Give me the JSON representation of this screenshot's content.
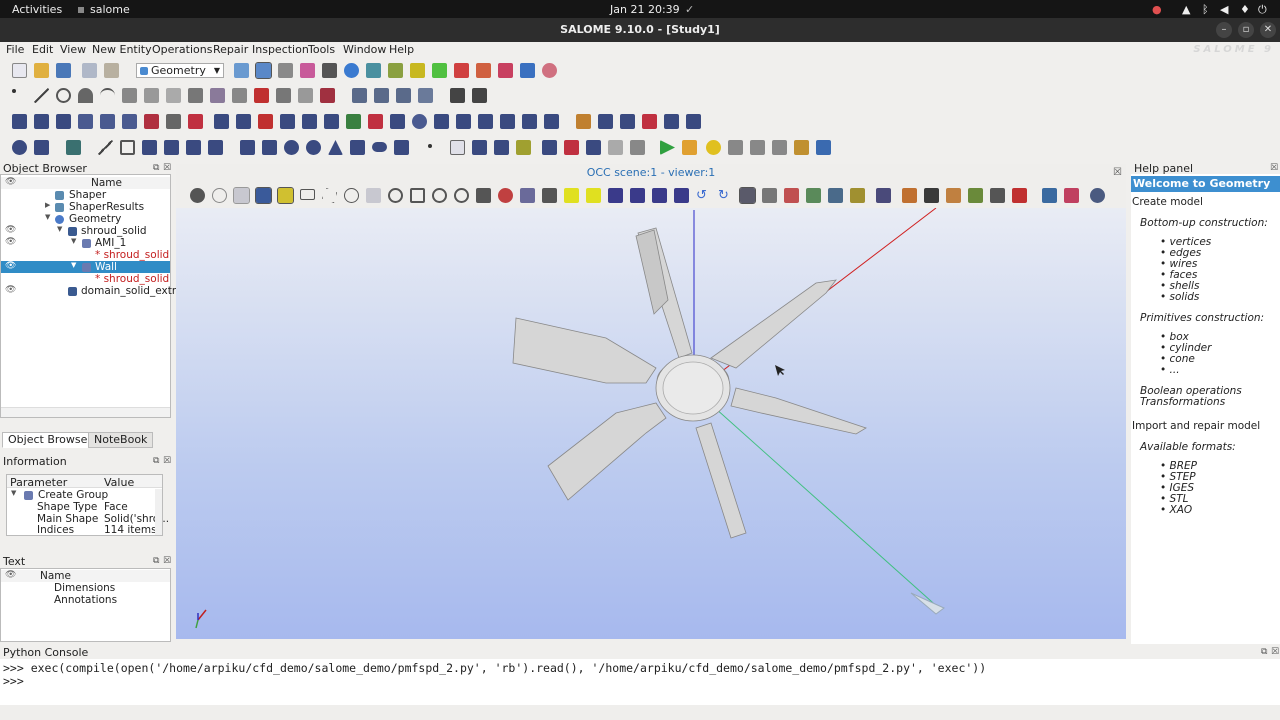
{
  "system_bar": {
    "activities": "Activities",
    "app": "salome",
    "clock": "Jan 21  20:39"
  },
  "window": {
    "title": "SALOME 9.10.0 - [Study1]",
    "brand": "SALOME 9"
  },
  "menu": [
    "File",
    "Edit",
    "View",
    "New Entity",
    "Operations",
    "Repair",
    "Inspection",
    "Tools",
    "Window",
    "Help"
  ],
  "module_combo": "Geometry",
  "object_browser": {
    "title": "Object Browser",
    "column": "Name",
    "items": [
      {
        "label": "Shaper"
      },
      {
        "label": "ShaperResults"
      },
      {
        "label": "Geometry"
      },
      {
        "label": "shroud_solid"
      },
      {
        "label": "AMI_1"
      },
      {
        "label": "* shroud_solid"
      },
      {
        "label": "Wall"
      },
      {
        "label": "* shroud_solid"
      },
      {
        "label": "domain_solid_extr"
      }
    ],
    "tabs": [
      "Object Browser",
      "NoteBook"
    ]
  },
  "information": {
    "title": "Information",
    "columns": [
      "Parameter",
      "Value"
    ],
    "rows": [
      {
        "param": "Create Group",
        "value": ""
      },
      {
        "param": "Shape Type",
        "value": "Face"
      },
      {
        "param": "Main Shape",
        "value": "Solid('shro..."
      },
      {
        "param": "Indices",
        "value": "114 items:"
      }
    ]
  },
  "text_panel": {
    "title": "Text",
    "column": "Name",
    "items": [
      "Dimensions",
      "Annotations"
    ]
  },
  "viewer": {
    "title": "OCC scene:1 - viewer:1"
  },
  "help_panel": {
    "title": "Help panel",
    "welcome": "Welcome to Geometry",
    "create_model": "Create model",
    "bottom_up": "Bottom-up construction:",
    "bottom_up_items": [
      "vertices",
      "edges",
      "wires",
      "faces",
      "shells",
      "solids"
    ],
    "primitives": "Primitives construction:",
    "primitives_items": [
      "box",
      "cylinder",
      "cone",
      "..."
    ],
    "boolean": "Boolean operations",
    "transformations": "Transformations",
    "import_repair": "Import and repair model",
    "formats_title": "Available formats:",
    "formats": [
      "BREP",
      "STEP",
      "IGES",
      "STL",
      "XAO"
    ]
  },
  "python_console": {
    "title": "Python Console",
    "lines": [
      ">>> exec(compile(open('/home/arpiku/cfd_demo/salome_demo/pmfspd_2.py', 'rb').read(), '/home/arpiku/cfd_demo/salome_demo/pmfspd_2.py', 'exec'))",
      ">>>"
    ]
  }
}
